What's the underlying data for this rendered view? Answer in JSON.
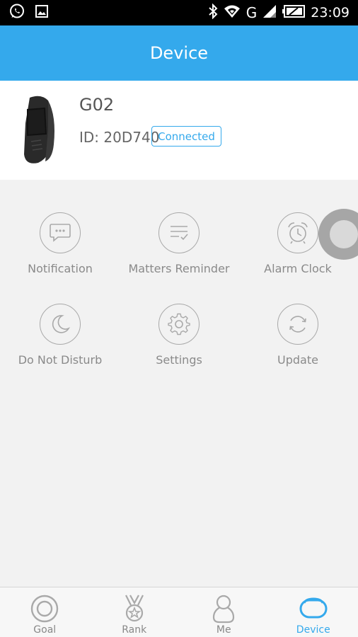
{
  "status_bar": {
    "network": "G",
    "time": "23:09"
  },
  "header": {
    "title": "Device"
  },
  "device": {
    "name": "G02",
    "id_text": "ID: 20D740",
    "status": "Connected"
  },
  "grid": [
    {
      "label": "Notification",
      "icon": "chat-bubble-icon"
    },
    {
      "label": "Matters Reminder",
      "icon": "reminder-list-icon"
    },
    {
      "label": "Alarm Clock",
      "icon": "alarm-clock-icon"
    },
    {
      "label": "Do Not Disturb",
      "icon": "moon-icon"
    },
    {
      "label": "Settings",
      "icon": "gear-icon"
    },
    {
      "label": "Update",
      "icon": "refresh-icon"
    }
  ],
  "bottom_nav": [
    {
      "label": "Goal",
      "icon": "target-icon",
      "active": false
    },
    {
      "label": "Rank",
      "icon": "medal-icon",
      "active": false
    },
    {
      "label": "Me",
      "icon": "person-icon",
      "active": false
    },
    {
      "label": "Device",
      "icon": "band-icon",
      "active": true
    }
  ],
  "colors": {
    "accent": "#34a9ec",
    "background": "#f2f2f2",
    "icon_gray": "#a9a9a9",
    "label_gray": "#8a8a8a"
  }
}
